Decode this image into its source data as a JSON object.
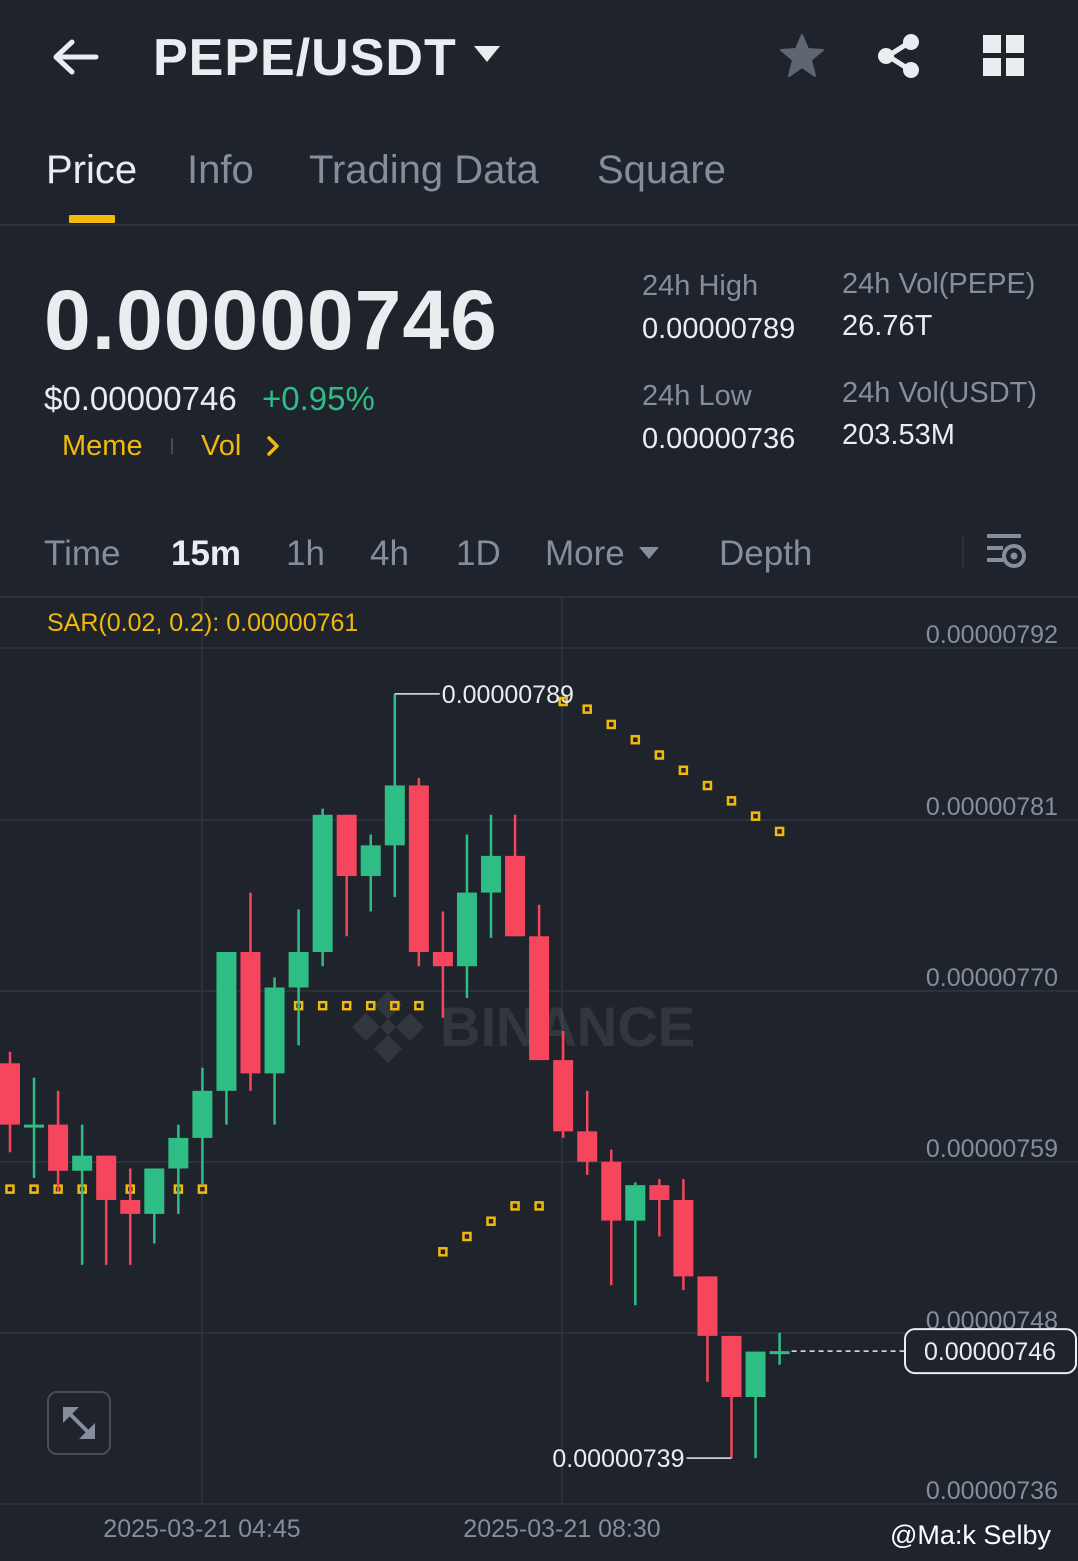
{
  "header": {
    "title": "PEPE/USDT",
    "icons": [
      "back-arrow-icon",
      "caret-down-icon",
      "star-icon",
      "share-icon",
      "grid-icon"
    ]
  },
  "tabs": [
    {
      "label": "Price",
      "active": true
    },
    {
      "label": "Info",
      "active": false
    },
    {
      "label": "Trading Data",
      "active": false
    },
    {
      "label": "Square",
      "active": false
    }
  ],
  "price": {
    "last": "0.00000746",
    "usd": "$0.00000746",
    "change": "+0.95%",
    "tags": [
      "Meme",
      "Vol"
    ]
  },
  "stats": {
    "high_label": "24h High",
    "high_value": "0.00000789",
    "low_label": "24h Low",
    "low_value": "0.00000736",
    "vol_base_label": "24h Vol(PEPE)",
    "vol_base_value": "26.76T",
    "vol_quote_label": "24h Vol(USDT)",
    "vol_quote_value": "203.53M"
  },
  "timeframes": {
    "items": [
      "Time",
      "15m",
      "1h",
      "4h",
      "1D",
      "More",
      "Depth"
    ],
    "active": "15m"
  },
  "chart_data": {
    "type": "candlestick",
    "indicator": "SAR(0.02, 0.2): 0.00000761",
    "y_ticks": [
      "0.00000792",
      "0.00000781",
      "0.00000770",
      "0.00000759",
      "0.00000748",
      "0.00000736"
    ],
    "ylim": [
      7.36e-06,
      7.92e-06
    ],
    "x_ticks": [
      "2025-03-21 04:45",
      "2025-03-21 08:30"
    ],
    "current_price_label": "0.00000746",
    "high_marker": "0.00000789",
    "low_marker": "0.00000739",
    "watermark": "BINANCE",
    "candles": [
      {
        "o": 7.6483,
        "h": 7.6559,
        "l": 7.5901,
        "c": 7.6082
      },
      {
        "o": 7.6082,
        "h": 7.6389,
        "l": 7.5733,
        "c": 7.6082
      },
      {
        "o": 7.6082,
        "h": 7.6303,
        "l": 7.5643,
        "c": 7.578
      },
      {
        "o": 7.578,
        "h": 7.6082,
        "l": 7.5164,
        "c": 7.5879
      },
      {
        "o": 7.5879,
        "h": 7.5839,
        "l": 7.5164,
        "c": 7.5589
      },
      {
        "o": 7.5589,
        "h": 7.5795,
        "l": 7.5164,
        "c": 7.5498
      },
      {
        "o": 7.5498,
        "h": 7.5795,
        "l": 7.5304,
        "c": 7.5795
      },
      {
        "o": 7.5795,
        "h": 7.6082,
        "l": 7.5498,
        "c": 7.5995
      },
      {
        "o": 7.5995,
        "h": 7.6454,
        "l": 7.5693,
        "c": 7.6303
      },
      {
        "o": 7.6303,
        "h": 7.7045,
        "l": 7.6082,
        "c": 7.7211
      },
      {
        "o": 7.7211,
        "h": 7.76,
        "l": 7.6303,
        "c": 7.6417
      },
      {
        "o": 7.6417,
        "h": 7.7045,
        "l": 7.6082,
        "c": 7.6979
      },
      {
        "o": 7.6979,
        "h": 7.749,
        "l": 7.66,
        "c": 7.7211
      },
      {
        "o": 7.7211,
        "h": 7.8149,
        "l": 7.7118,
        "c": 7.8109
      },
      {
        "o": 7.8109,
        "h": 7.8009,
        "l": 7.7314,
        "c": 7.7708
      },
      {
        "o": 7.7708,
        "h": 7.798,
        "l": 7.7476,
        "c": 7.7909
      },
      {
        "o": 7.7909,
        "h": 7.89,
        "l": 7.757,
        "c": 7.8301
      },
      {
        "o": 7.8301,
        "h": 7.8349,
        "l": 7.7118,
        "c": 7.7211
      },
      {
        "o": 7.7211,
        "h": 7.7476,
        "l": 7.6781,
        "c": 7.7118
      },
      {
        "o": 7.7118,
        "h": 7.798,
        "l": 7.691,
        "c": 7.76
      },
      {
        "o": 7.76,
        "h": 7.8109,
        "l": 7.7304,
        "c": 7.784
      },
      {
        "o": 7.784,
        "h": 7.8109,
        "l": 7.741,
        "c": 7.7314
      },
      {
        "o": 7.7314,
        "h": 7.752,
        "l": 7.66,
        "c": 7.6504
      },
      {
        "o": 7.6504,
        "h": 7.6694,
        "l": 7.5995,
        "c": 7.6038
      },
      {
        "o": 7.6038,
        "h": 7.6303,
        "l": 7.5753,
        "c": 7.5839
      },
      {
        "o": 7.5839,
        "h": 7.5918,
        "l": 7.5031,
        "c": 7.5454
      },
      {
        "o": 7.5454,
        "h": 7.5704,
        "l": 7.49,
        "c": 7.5686
      },
      {
        "o": 7.5686,
        "h": 7.5726,
        "l": 7.535,
        "c": 7.5589
      },
      {
        "o": 7.5589,
        "h": 7.5726,
        "l": 7.5,
        "c": 7.5089
      },
      {
        "o": 7.5089,
        "h": 7.4944,
        "l": 7.44,
        "c": 7.47
      },
      {
        "o": 7.47,
        "h": 7.47,
        "l": 7.39,
        "c": 7.43
      },
      {
        "o": 7.43,
        "h": 7.4597,
        "l": 7.39,
        "c": 7.4597
      },
      {
        "o": 7.4597,
        "h": 7.472,
        "l": 7.4511,
        "c": 7.46
      }
    ],
    "sar": [
      7.566,
      7.566,
      7.566,
      7.566,
      7.566,
      7.566,
      7.566,
      7.566,
      7.566,
      7.686,
      7.686,
      7.686,
      7.686,
      7.686,
      7.686,
      7.686,
      7.686,
      7.686,
      7.525,
      7.535,
      7.545,
      7.555,
      7.555,
      7.885,
      7.88,
      7.87,
      7.86,
      7.85,
      7.84,
      7.83,
      7.82,
      7.81,
      7.8
    ],
    "sar_start_offset": 0
  },
  "watermark_text": "@Ma:k Selby"
}
